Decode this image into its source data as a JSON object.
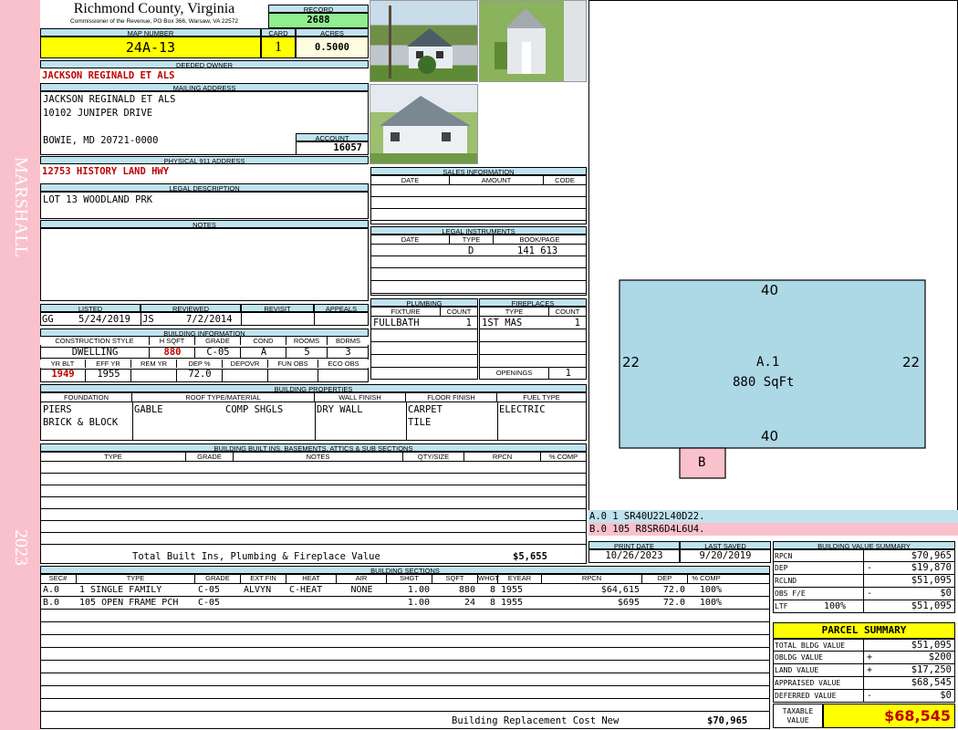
{
  "sidebar": {
    "area": "MARSHALL",
    "year": "2023"
  },
  "header": {
    "county": "Richmond County, Virginia",
    "address": "Commissioner of the Revenue, PO Box 366, Warsaw, VA 22572",
    "record_label": "RECORD",
    "record": "2688"
  },
  "parcel": {
    "map_label": "MAP NUMBER",
    "map": "24A-13",
    "card_label": "CARD",
    "card": "1",
    "acres_label": "ACRES",
    "acres": "0.5000"
  },
  "owner": {
    "deeded_label": "DEEDED OWNER",
    "deeded": "JACKSON REGINALD ET ALS",
    "mailing_label": "MAILING ADDRESS",
    "line1": "JACKSON REGINALD ET ALS",
    "line2": "10102 JUNIPER DRIVE",
    "line3": "BOWIE, MD 20721-0000",
    "account_label": "ACCOUNT",
    "account": "16057"
  },
  "physical": {
    "label": "PHYSICAL 911 ADDRESS",
    "value": "12753 HISTORY LAND HWY"
  },
  "legal": {
    "label": "LEGAL DESCRIPTION",
    "value": "LOT 13 WOODLAND PRK"
  },
  "notes": {
    "label": "NOTES"
  },
  "sales": {
    "label": "SALES INFORMATION",
    "cols": [
      "DATE",
      "AMOUNT",
      "CODE"
    ]
  },
  "instruments": {
    "label": "LEGAL INSTRUMENTS",
    "cols": [
      "DATE",
      "TYPE",
      "BOOK/PAGE"
    ],
    "type": "D",
    "bookpage": "141 613"
  },
  "listed": {
    "listed_label": "LISTED",
    "listed_by": "GG",
    "listed_date": "5/24/2019",
    "reviewed_label": "REVIEWED",
    "reviewed_by": "JS",
    "reviewed_date": "7/2/2014",
    "revisit_label": "REVISIT",
    "appeals_label": "APPEALS"
  },
  "building_info": {
    "label": "BUILDING INFORMATION",
    "cols": [
      "CONSTRUCTION STYLE",
      "H SQFT",
      "GRADE",
      "COND",
      "ROOMS",
      "BDRMS"
    ],
    "style": "DWELLING",
    "hsqft": "880",
    "grade": "C-05",
    "cond": "A",
    "rooms": "5",
    "bdrms": "3",
    "cols2": [
      "YR BLT",
      "EFF YR",
      "REM YR",
      "DEP %",
      "DEPOVR",
      "FUN OBS",
      "ECO OBS"
    ],
    "yrblt": "1949",
    "effyr": "1955",
    "dep": "72.0"
  },
  "plumbing": {
    "label": "PLUMBING",
    "cols": [
      "FIXTURE",
      "COUNT"
    ],
    "fixture": "FULLBATH",
    "count": "1"
  },
  "fireplaces": {
    "label": "FIREPLACES",
    "cols": [
      "TYPE",
      "COUNT"
    ],
    "type": "1ST MAS",
    "count": "1",
    "openings_label": "OPENINGS",
    "openings": "1"
  },
  "properties": {
    "label": "BUILDING PROPERTIES",
    "cols": [
      "FOUNDATION",
      "ROOF TYPE/MATERIAL",
      "WALL FINISH",
      "FLOOR FINISH",
      "FUEL TYPE"
    ],
    "foundation1": "PIERS",
    "foundation2": "BRICK & BLOCK",
    "roof_type": "GABLE",
    "roof_material": "COMP SHGLS",
    "wall": "DRY WALL",
    "floor1": "CARPET",
    "floor2": "TILE",
    "fuel": "ELECTRIC"
  },
  "builtins": {
    "label": "BUILDING BUILT INS, BASEMENTS, ATTICS & SUB SECTIONS",
    "cols": [
      "TYPE",
      "GRADE",
      "NOTES",
      "QTY/SIZE",
      "RPCN",
      "% COMP"
    ],
    "total_label": "Total Built Ins, Plumbing & Fireplace Value",
    "total": "$5,655"
  },
  "sections": {
    "label": "BUILDING SECTIONS",
    "cols": [
      "SEC#",
      "TYPE",
      "GRADE",
      "EXT FIN",
      "HEAT",
      "AIR",
      "SHGT",
      "SQFT",
      "WHGT",
      "EYEAR",
      "RPCN",
      "DEP",
      "% COMP"
    ],
    "rows": [
      {
        "sec": "A.0",
        "type": "1 SINGLE FAMILY",
        "grade": "C-05",
        "ext": "ALVYN",
        "heat": "C-HEAT",
        "air": "NONE",
        "shgt": "1.00",
        "sqft": "880",
        "whgt": "8",
        "eyear": "1955",
        "rpcn": "$64,615",
        "dep": "72.0",
        "comp": "100%"
      },
      {
        "sec": "B.0",
        "type": "105 OPEN FRAME PCH",
        "grade": "C-05",
        "ext": "",
        "heat": "",
        "air": "",
        "shgt": "1.00",
        "sqft": "24",
        "whgt": "8",
        "eyear": "1955",
        "rpcn": "$695",
        "dep": "72.0",
        "comp": "100%"
      }
    ],
    "brcn_label": "Building Replacement Cost New",
    "brcn": "$70,965"
  },
  "sketch": {
    "top": "40",
    "bottom": "40",
    "left": "22",
    "right": "22",
    "label": "A.1",
    "area": "880 SqFt",
    "porch": "B",
    "code1": "A.0  1    SR40U22L40D22.",
    "code2": "B.0  105  R8SR6D4L6U4."
  },
  "dates": {
    "print_label": "PRINT DATE",
    "print": "10/26/2023",
    "saved_label": "LAST SAVED",
    "saved": "9/20/2019"
  },
  "bvs": {
    "label": "BUILDING VALUE SUMMARY",
    "rows": [
      {
        "k": "RPCN",
        "s": "",
        "v": "$70,965"
      },
      {
        "k": "DEP",
        "s": "-",
        "v": "$19,870"
      },
      {
        "k": "RCLND",
        "s": "",
        "v": "$51,095"
      },
      {
        "k": "OBS F/E",
        "s": "-",
        "v": "$0"
      },
      {
        "k": "LTF",
        "s": "100%",
        "v": "$51,095"
      }
    ]
  },
  "summary": {
    "label": "PARCEL SUMMARY",
    "rows": [
      {
        "k": "TOTAL BLDG VALUE",
        "s": "",
        "v": "$51,095"
      },
      {
        "k": "OBLDG VALUE",
        "s": "+",
        "v": "$200"
      },
      {
        "k": "LAND VALUE",
        "s": "+",
        "v": "$17,250"
      },
      {
        "k": "APPRAISED VALUE",
        "s": "",
        "v": "$68,545"
      },
      {
        "k": "DEFERRED VALUE",
        "s": "-",
        "v": "$0"
      }
    ],
    "taxable_label1": "TAXABLE",
    "taxable_label2": "VALUE",
    "taxable": "$68,545"
  },
  "colors": {
    "header_bg": "#bfe3ef",
    "sidebar": "#f9c1cc",
    "yellow": "#ffff00",
    "red": "#c00000",
    "sketch": "#add8e6"
  }
}
